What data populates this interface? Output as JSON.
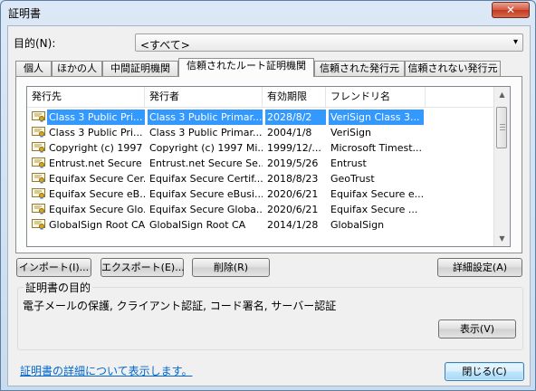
{
  "window": {
    "title": "証明書",
    "close_glyph": "✕"
  },
  "purpose": {
    "label": "目的(N):",
    "selected": "<すべて>",
    "arrow": "▾"
  },
  "tabs": [
    {
      "label": "個人"
    },
    {
      "label": "ほかの人"
    },
    {
      "label": "中間証明機関"
    },
    {
      "label": "信頼されたルート証明機関",
      "active": true
    },
    {
      "label": "信頼された発行元"
    },
    {
      "label": "信頼されない発行元"
    }
  ],
  "list": {
    "columns": [
      "発行先",
      "発行者",
      "有効期限",
      "フレンドリ名"
    ],
    "rows": [
      {
        "issued_to": "Class 3 Public Pri...",
        "issued_by": "Class 3 Public Primar...",
        "expires": "2028/8/2",
        "friendly": "VeriSign Class 3...",
        "selected": true
      },
      {
        "issued_to": "Class 3 Public Pri...",
        "issued_by": "Class 3 Public Primar...",
        "expires": "2004/1/8",
        "friendly": "VeriSign"
      },
      {
        "issued_to": "Copyright (c) 1997 ...",
        "issued_by": "Copyright (c) 1997 Mi...",
        "expires": "1999/12/...",
        "friendly": "Microsoft Timest..."
      },
      {
        "issued_to": "Entrust.net Secure ...",
        "issued_by": "Entrust.net Secure Se...",
        "expires": "2019/5/26",
        "friendly": "Entrust"
      },
      {
        "issued_to": "Equifax Secure Cer...",
        "issued_by": "Equifax Secure Certif...",
        "expires": "2018/8/23",
        "friendly": "GeoTrust"
      },
      {
        "issued_to": "Equifax Secure eB...",
        "issued_by": "Equifax Secure eBusi...",
        "expires": "2020/6/21",
        "friendly": "Equifax Secure e..."
      },
      {
        "issued_to": "Equifax Secure Glo...",
        "issued_by": "Equifax Secure Globa...",
        "expires": "2020/6/21",
        "friendly": "Equifax Secure ..."
      },
      {
        "issued_to": "GlobalSign Root CA",
        "issued_by": "GlobalSign Root CA",
        "expires": "2014/1/28",
        "friendly": "GlobalSign"
      }
    ]
  },
  "buttons": {
    "import": "インポート(I)...",
    "export": "エクスポート(E)...",
    "delete": "削除(R)",
    "advanced": "詳細設定(A)",
    "view": "表示(V)",
    "close": "閉じる(C)"
  },
  "purpose_group": {
    "title": "証明書の目的",
    "text": "電子メールの保護, クライアント認証, コード署名, サーバー認証"
  },
  "details_link": "証明書の詳細について表示します。"
}
